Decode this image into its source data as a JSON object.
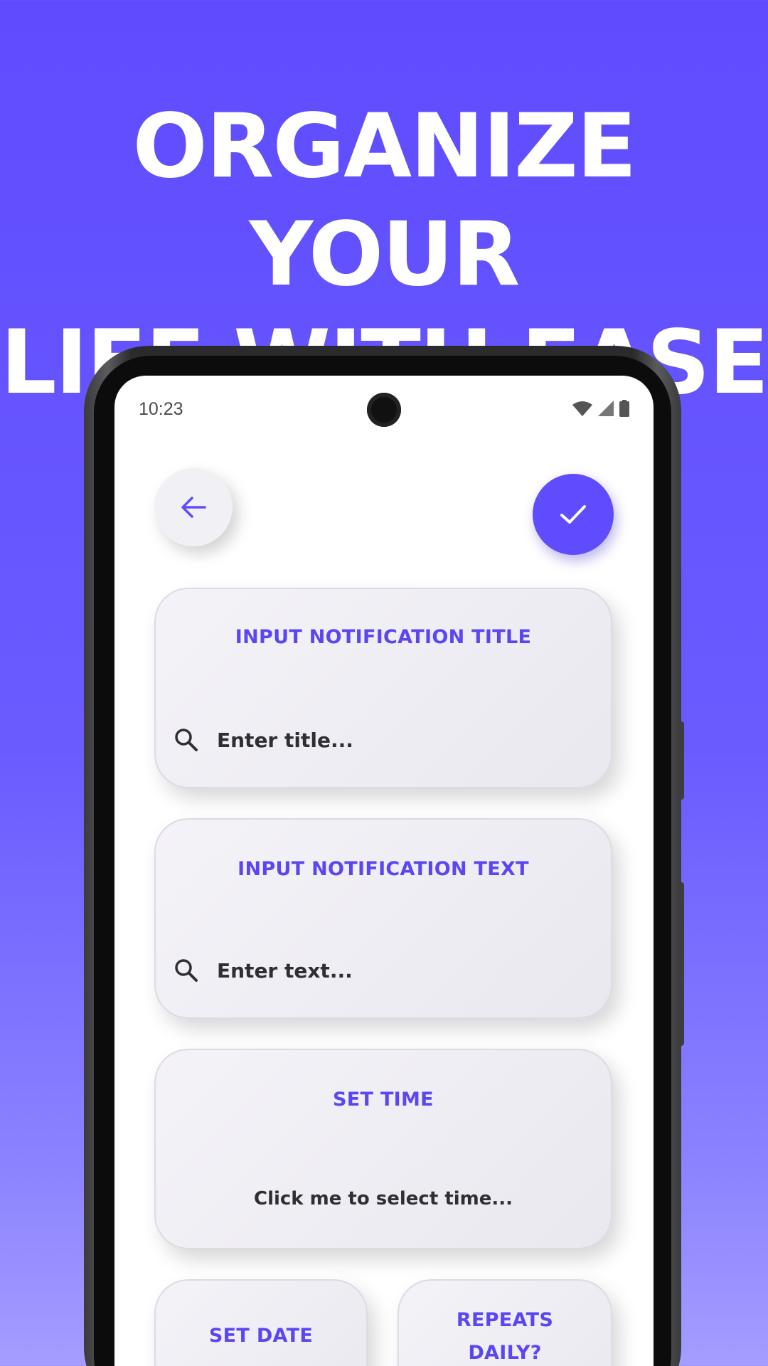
{
  "headline": {
    "line1": "ORGANIZE YOUR",
    "line2": "LIFE WITH EASE"
  },
  "status_bar": {
    "time": "10:23"
  },
  "colors": {
    "accent": "#5f4cff",
    "card_bg": "#f1f0f5",
    "text_dark": "#2f2f33"
  },
  "icons": {
    "back": "arrow-left-icon",
    "confirm": "check-icon",
    "search": "search-icon"
  },
  "notification_title_card": {
    "title": "INPUT NOTIFICATION TITLE",
    "placeholder": "Enter title..."
  },
  "notification_text_card": {
    "title": "INPUT NOTIFICATION TEXT",
    "placeholder": "Enter text..."
  },
  "time_card": {
    "title": "SET TIME",
    "value": "Click me to select time..."
  },
  "date_card": {
    "title": "SET DATE"
  },
  "repeat_card": {
    "title_line1": "REPEATS",
    "title_line2": "DAILY?"
  }
}
